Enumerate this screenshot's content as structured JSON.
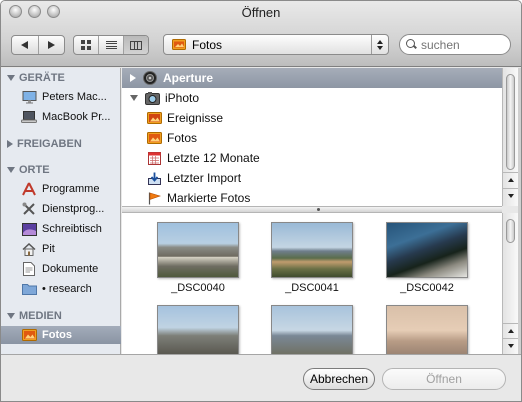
{
  "window": {
    "title": "Öffnen"
  },
  "toolbar": {
    "location": "Fotos",
    "search_placeholder": "suchen"
  },
  "sidebar": {
    "sections": {
      "geraete": "GERÄTE",
      "freigaben": "FREIGABEN",
      "orte": "ORTE",
      "medien": "MEDIEN"
    },
    "geraete_items": [
      "Peters Mac...",
      "MacBook Pr..."
    ],
    "orte_items": [
      "Programme",
      "Dienstprog...",
      "Schreibtisch",
      "Pit",
      "Dokumente",
      "• research"
    ],
    "medien_items": [
      "Fotos"
    ]
  },
  "browser": {
    "rows": [
      "Aperture",
      "iPhoto",
      "Ereignisse",
      "Fotos",
      "Letzte 12 Monate",
      "Letzter Import",
      "Markierte Fotos"
    ]
  },
  "thumbnails": [
    "_DSC0040",
    "_DSC0041",
    "_DSC0042"
  ],
  "buttons": {
    "cancel": "Abbrechen",
    "open": "Öffnen"
  }
}
